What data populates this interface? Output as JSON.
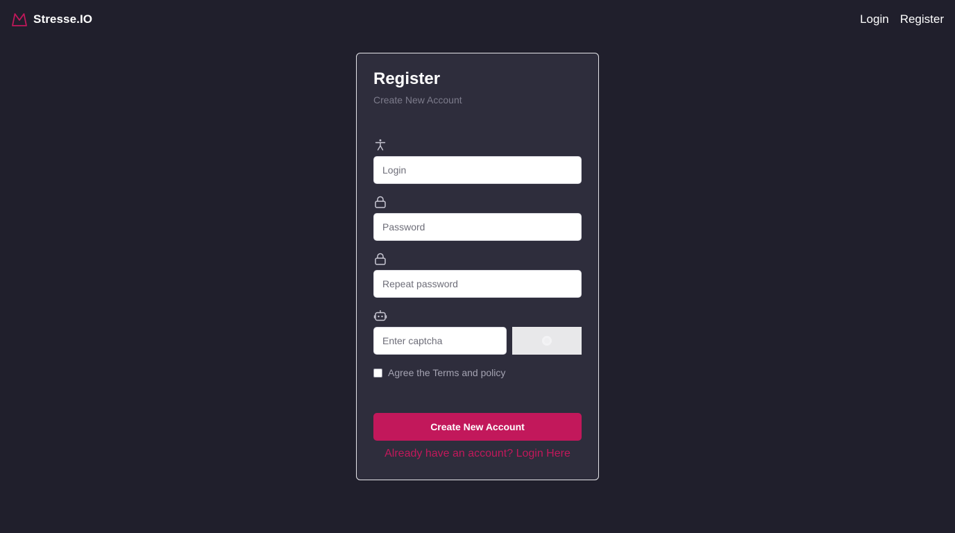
{
  "colors": {
    "background": "#201f2c",
    "card": "#2e2d3c",
    "accent": "#c2185b",
    "muted_text": "#7d7c8c"
  },
  "navbar": {
    "brand_icon": "crown-m-logo-icon",
    "brand_name": "Stresse.IO",
    "links": [
      {
        "label": "Login"
      },
      {
        "label": "Register"
      }
    ]
  },
  "form": {
    "title": "Register",
    "subtitle": "Create New Account",
    "fields": {
      "login": {
        "icon": "accessibility-person-icon",
        "placeholder": "Login",
        "value": ""
      },
      "password": {
        "icon": "lock-icon",
        "placeholder": "Password",
        "value": ""
      },
      "repeat_password": {
        "icon": "lock-icon",
        "placeholder": "Repeat password",
        "value": ""
      },
      "captcha": {
        "icon": "robot-icon",
        "placeholder": "Enter captcha",
        "value": ""
      }
    },
    "agree_label": "Agree the Terms and policy",
    "agree_checked": false,
    "submit_label": "Create New Account",
    "login_link": "Already have an account? Login Here"
  }
}
